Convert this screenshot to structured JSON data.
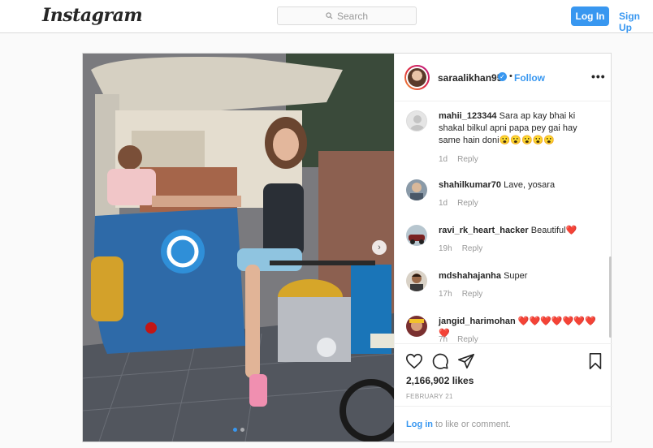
{
  "topbar": {
    "logo": "Instagram",
    "search_placeholder": "Search",
    "login_label": "Log In",
    "signup_label": "Sign Up"
  },
  "post": {
    "username": "saraalikhan95",
    "dot": "•",
    "follow_label": "Follow",
    "more": "•••",
    "likes": "2,166,902 likes",
    "date": "FEBRUARY 21",
    "login_link": "Log in",
    "login_rest": " to like or comment.",
    "carousel_count": 2,
    "carousel_index": 1
  },
  "comments": [
    {
      "user": "mahii_123344",
      "text": " Sara ap kay bhai ki shakal bilkul apni papa pey gai hay same hain doni😮😮😮😮😮",
      "time": "1d",
      "reply": "Reply"
    },
    {
      "user": "shahilkumar70",
      "text": " Lave, yosara",
      "time": "1d",
      "reply": "Reply"
    },
    {
      "user": "ravi_rk_heart_hacker",
      "text": " Beautiful❤️",
      "time": "19h",
      "reply": "Reply"
    },
    {
      "user": "mdshahajanha",
      "text": " Super",
      "time": "17h",
      "reply": "Reply"
    },
    {
      "user": "jangid_harimohan",
      "text": " ❤️❤️❤️❤️❤️❤️❤️❤️",
      "time": "7h",
      "reply": "Reply"
    }
  ],
  "icons": {
    "search": "search-icon",
    "like": "heart-icon",
    "comment": "comment-icon",
    "share": "share-icon",
    "save": "bookmark-icon"
  },
  "colors": {
    "accent": "#3897f0",
    "muted": "#999999",
    "border": "#dbdbdb"
  }
}
